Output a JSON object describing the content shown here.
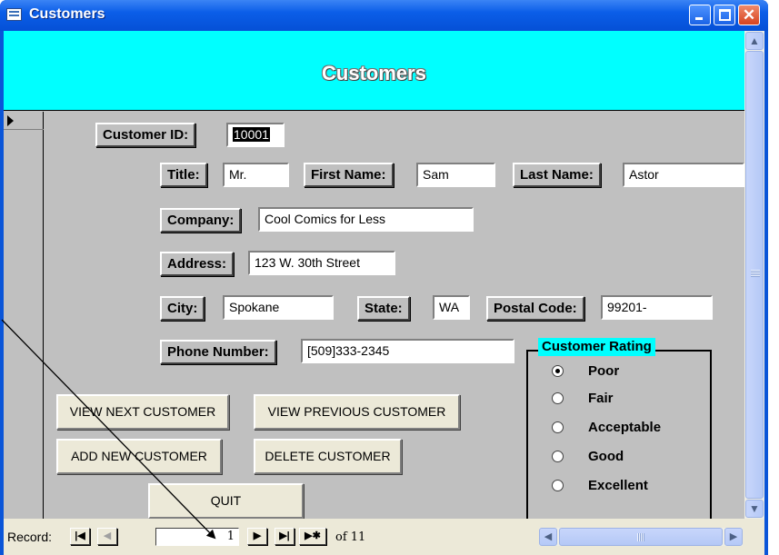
{
  "window": {
    "title": "Customers"
  },
  "header": {
    "title": "Customers"
  },
  "form": {
    "customer_id": {
      "label": "Customer ID:",
      "value": "10001"
    },
    "title": {
      "label": "Title:",
      "value": "Mr."
    },
    "first_name": {
      "label": "First Name:",
      "value": "Sam"
    },
    "last_name": {
      "label": "Last Name:",
      "value": "Astor"
    },
    "company": {
      "label": "Company:",
      "value": "Cool Comics for Less"
    },
    "address": {
      "label": "Address:",
      "value": "123 W. 30th Street"
    },
    "city": {
      "label": "City:",
      "value": "Spokane"
    },
    "state": {
      "label": "State:",
      "value": "WA"
    },
    "postal_code": {
      "label": "Postal Code:",
      "value": "99201-"
    },
    "phone": {
      "label": "Phone Number:",
      "value": "[509]333-2345"
    }
  },
  "rating": {
    "title": "Customer Rating",
    "selected": "Poor",
    "options": [
      "Poor",
      "Fair",
      "Acceptable",
      "Good",
      "Excellent"
    ]
  },
  "buttons": {
    "view_next": "VIEW NEXT CUSTOMER",
    "view_previous": "VIEW PREVIOUS CUSTOMER",
    "add_new": "ADD NEW CUSTOMER",
    "delete": "DELETE CUSTOMER",
    "quit": "QUIT"
  },
  "record_nav": {
    "label": "Record:",
    "current": "1",
    "of_text": "of 11"
  },
  "colors": {
    "header_background": "#00ffff",
    "form_background": "#c0c0c0",
    "titlebar": "#0550d6"
  }
}
